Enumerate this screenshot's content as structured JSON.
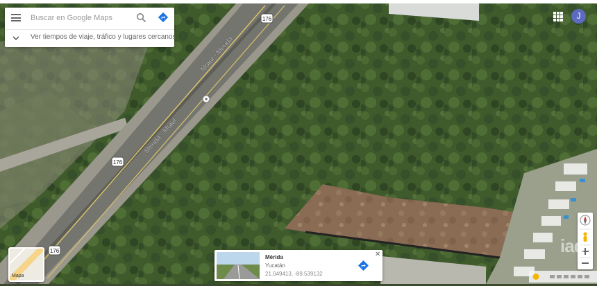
{
  "search": {
    "placeholder": "Buscar en Google Maps",
    "nearby_label": "Ver tiempos de viaje, tráfico y lugares cercanos"
  },
  "user": {
    "initial": "J"
  },
  "map": {
    "roads": [
      {
        "name": "Motul - Mérida"
      },
      {
        "name": "Mérida - Motul"
      }
    ],
    "shields": [
      "176",
      "176",
      "176"
    ],
    "colors": {
      "vegetation": "#3f5a2b",
      "road": "#7a7a74",
      "cleared_lot": "#8a6a52",
      "center_line": "#d8c46a",
      "avatar": "#5c6bc0",
      "direction": "#1a73e8"
    }
  },
  "minimap": {
    "label": "Mapa"
  },
  "place_card": {
    "title": "Mérida",
    "subtitle": "Yucatán",
    "coords": "21.049413, -89.539132"
  }
}
